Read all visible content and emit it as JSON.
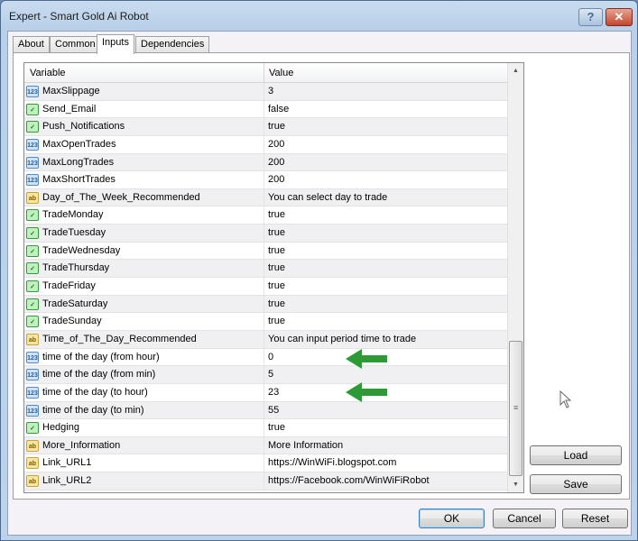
{
  "window": {
    "title": "Expert - Smart Gold Ai Robot",
    "help_label": "?",
    "close_label": "✕"
  },
  "tabs": [
    {
      "label": "About"
    },
    {
      "label": "Common"
    },
    {
      "label": "Inputs",
      "active": true
    },
    {
      "label": "Dependencies"
    }
  ],
  "table": {
    "headers": {
      "variable": "Variable",
      "value": "Value"
    },
    "type_labels": {
      "num": "123",
      "bool": "✓",
      "str": "ab"
    },
    "rows": [
      {
        "type": "num",
        "variable": "MaxSlippage",
        "value": "3"
      },
      {
        "type": "bool",
        "variable": "Send_Email",
        "value": "false"
      },
      {
        "type": "bool",
        "variable": "Push_Notifications",
        "value": "true"
      },
      {
        "type": "num",
        "variable": "MaxOpenTrades",
        "value": "200"
      },
      {
        "type": "num",
        "variable": "MaxLongTrades",
        "value": "200"
      },
      {
        "type": "num",
        "variable": "MaxShortTrades",
        "value": "200"
      },
      {
        "type": "str",
        "variable": "Day_of_The_Week_Recommended",
        "value": "You can select day to trade"
      },
      {
        "type": "bool",
        "variable": "TradeMonday",
        "value": "true"
      },
      {
        "type": "bool",
        "variable": "TradeTuesday",
        "value": "true"
      },
      {
        "type": "bool",
        "variable": "TradeWednesday",
        "value": "true"
      },
      {
        "type": "bool",
        "variable": "TradeThursday",
        "value": "true"
      },
      {
        "type": "bool",
        "variable": "TradeFriday",
        "value": "true"
      },
      {
        "type": "bool",
        "variable": "TradeSaturday",
        "value": "true"
      },
      {
        "type": "bool",
        "variable": "TradeSunday",
        "value": "true"
      },
      {
        "type": "str",
        "variable": "Time_of_The_Day_Recommended",
        "value": "You can input period time to trade"
      },
      {
        "type": "num",
        "variable": "time of the day (from hour)",
        "value": "0"
      },
      {
        "type": "num",
        "variable": "time of the day (from min)",
        "value": "5"
      },
      {
        "type": "num",
        "variable": "time of the day (to hour)",
        "value": "23"
      },
      {
        "type": "num",
        "variable": "time of the day (to min)",
        "value": "55"
      },
      {
        "type": "bool",
        "variable": "Hedging",
        "value": "true"
      },
      {
        "type": "str",
        "variable": "More_Information",
        "value": "More Information"
      },
      {
        "type": "str",
        "variable": "Link_URL1",
        "value": "https://WinWiFi.blogspot.com"
      },
      {
        "type": "str",
        "variable": "Link_URL2",
        "value": "https://Facebook.com/WinWiFiRobot"
      }
    ]
  },
  "side_buttons": {
    "load": "Load",
    "save": "Save"
  },
  "footer": {
    "ok": "OK",
    "cancel": "Cancel",
    "reset": "Reset"
  },
  "colors": {
    "arrow": "#2e9a35"
  }
}
